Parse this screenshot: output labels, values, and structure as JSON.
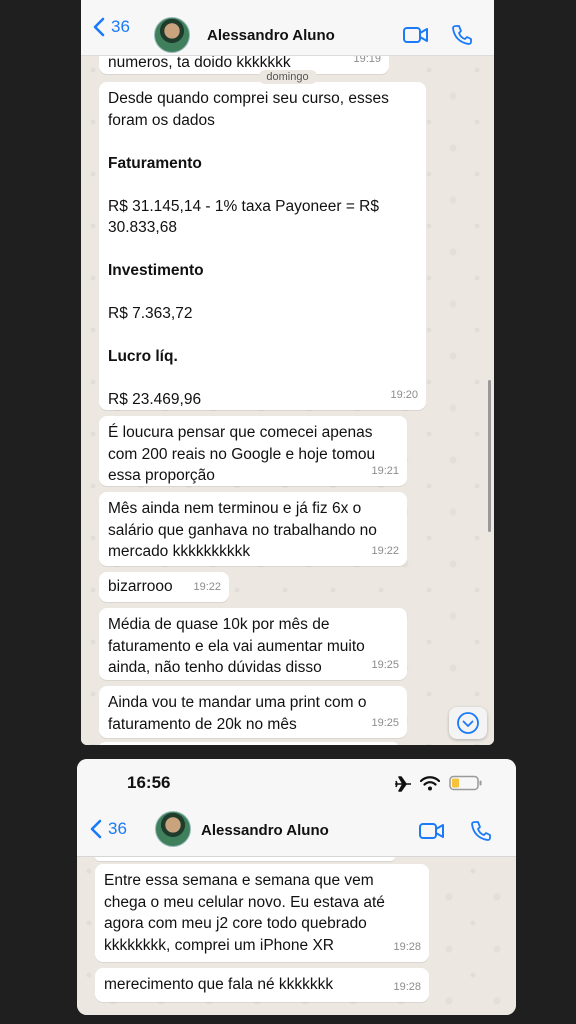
{
  "top_chat": {
    "back_count": "36",
    "contact_name": "Alessandro Aluno",
    "partial_message": "numeros, ta doido kkkkkkk",
    "partial_time": "19:19",
    "day_label": "domingo",
    "messages": [
      {
        "lines": [
          "Desde quando comprei seu curso, esses foram os dados",
          "",
          "Faturamento",
          "",
          "R$ 31.145,14 - 1% taxa Payoneer = R$ 30.833,68",
          "",
          "Investimento",
          "",
          "R$ 7.363,72",
          "",
          "Lucro líq.",
          "",
          "R$ 23.469,96"
        ],
        "time": "19:20"
      },
      {
        "text": "É loucura pensar que comecei apenas com 200 reais no Google e hoje tomou essa proporção",
        "time": "19:21"
      },
      {
        "text": "Mês ainda nem terminou e já fiz 6x o salário que ganhava no trabalhando no mercado kkkkkkkkkk",
        "time": "19:22"
      },
      {
        "text": "bizarrooo",
        "time": "19:22"
      },
      {
        "text": "Média de quase 10k por mês de faturamento e ela vai aumentar muito ainda, não tenho dúvidas disso",
        "time": "19:25"
      },
      {
        "text": "Ainda vou te mandar uma print com o faturamento de 20k no mês",
        "time": "19:25"
      }
    ]
  },
  "bottom_chat": {
    "status_time": "16:56",
    "back_count": "36",
    "contact_name": "Alessandro Aluno",
    "messages": [
      {
        "text": "Entre essa semana e semana que vem chega o meu celular novo. Eu estava até agora com meu j2 core todo quebrado kkkkkkkk, comprei um iPhone XR",
        "time": "19:28"
      },
      {
        "text": "merecimento que fala né kkkkkkk",
        "time": "19:28"
      }
    ]
  }
}
